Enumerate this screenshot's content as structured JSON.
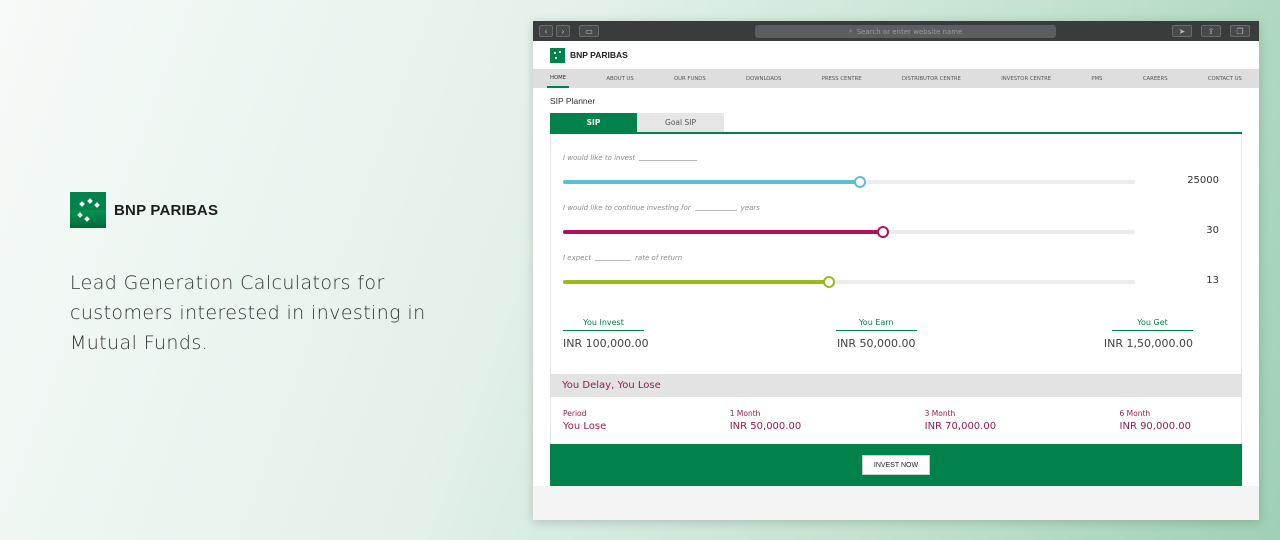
{
  "promo": {
    "brand": "BNP PARIBAS",
    "text": "Lead Generation Calculators for customers interested in investing in Mutual Funds."
  },
  "browser": {
    "address_placeholder": "Search or enter website name"
  },
  "site": {
    "brand": "BNP PARIBAS",
    "nav": [
      "HOME",
      "ABOUT US",
      "OUR FUNDS",
      "DOWNLOADS",
      "PRESS CENTRE",
      "DISTRIBUTOR CENTRE",
      "INVESTOR CENTRE",
      "PMS",
      "CAREERS",
      "CONTACT US"
    ],
    "page_title": "SIP Planner",
    "tabs": [
      "SIP",
      "Goal SIP"
    ]
  },
  "calculator": {
    "invest": {
      "label_pre": "I would like to invest",
      "label_post": "",
      "value": "25000",
      "fraction": 0.52,
      "color": "#5bc0d0"
    },
    "period": {
      "label_pre": "I would like to continue investing for",
      "label_post": "years",
      "value": "30",
      "fraction": 0.56,
      "color": "#b1105a"
    },
    "return": {
      "label_pre": "I expect",
      "label_post": "rate of return",
      "value": "13",
      "fraction": 0.465,
      "color": "#9ab91b"
    }
  },
  "results": {
    "invest": {
      "label": "You Invest",
      "value": "INR 100,000.00"
    },
    "earn": {
      "label": "You Earn",
      "value": "INR 50,000.00"
    },
    "get": {
      "label": "You Get",
      "value": "INR 1,50,000.00"
    }
  },
  "delay": {
    "title": "You Delay, You Lose",
    "columns": [
      {
        "label": "Period",
        "value": "You Lose"
      },
      {
        "label": "1 Month",
        "value": "INR 50,000.00"
      },
      {
        "label": "3 Month",
        "value": "INR 70,000.00"
      },
      {
        "label": "6 Month",
        "value": "INR 90,000.00"
      }
    ]
  },
  "cta": {
    "label": "INVEST NOW"
  },
  "colors": {
    "brand_green": "#00824a",
    "delay_red": "#8c1f52"
  }
}
